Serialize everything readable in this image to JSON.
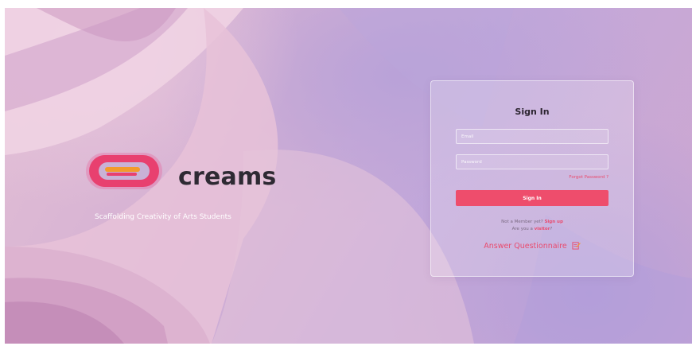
{
  "brand": {
    "name": "creams",
    "tagline": "Scaffolding Creativity of Arts Students"
  },
  "signin": {
    "title": "Sign In",
    "email_placeholder": "Email",
    "password_placeholder": "Password",
    "forgot_label": "Forgot Password ?",
    "button_label": "Sign In",
    "member_prompt": "Not a Member yet?",
    "signup_label": "Sign up",
    "visitor_prompt": "Are you a",
    "visitor_label": "visitor",
    "visitor_suffix": "?",
    "questionnaire_label": "Answer Questionnaire"
  },
  "colors": {
    "accent": "#ee4d6c",
    "logo_ring": "#e7407a",
    "logo_bar": "#f39a2c",
    "brand_text": "#2e2a33"
  },
  "icons": {
    "logo": "creams-logo",
    "questionnaire": "edit-note-icon"
  }
}
